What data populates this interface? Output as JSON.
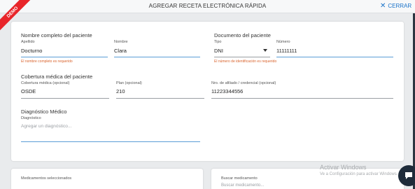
{
  "header": {
    "title": "AGREGAR RECETA ELECTRÓNICA RÁPIDA",
    "close_label": "CERRAR",
    "demo_badge": "DEMO"
  },
  "patient": {
    "section_title": "Nombre completo del paciente",
    "last_name_label": "Apellido",
    "last_name_value": "Docturno",
    "first_name_label": "Nombre",
    "first_name_value": "Clara",
    "error": "El nombre completo es requerido"
  },
  "document": {
    "section_title": "Documento del paciente",
    "type_label": "Tipo",
    "type_value": "DNI",
    "number_label": "Número",
    "number_value": "11111111",
    "error": "El número de identificación es requerido"
  },
  "coverage": {
    "section_title": "Cobertura médica del paciente",
    "coverage_label": "Cobertura médica (opcional)",
    "coverage_value": "OSDE",
    "plan_label": "Plan (opcional)",
    "plan_value": "210",
    "member_label": "Nro. de afiliado / credencial (opcional)",
    "member_value": "11223344556"
  },
  "diagnosis": {
    "section_title": "Diagnóstico Médico",
    "label": "Diagnóstico",
    "placeholder": "Agregar un diagnóstico..."
  },
  "medications": {
    "selected_title": "Medicamentos seleccionados",
    "search_title": "Buscar medicamento",
    "search_placeholder": "Buscar medicamento..."
  },
  "watermark": {
    "title": "Activar Windows",
    "subtitle": "Ve a Configuración para activar Windows."
  },
  "colors": {
    "accent": "#1a73c9",
    "error": "#d9622b",
    "ribbon": "#e8252a"
  }
}
